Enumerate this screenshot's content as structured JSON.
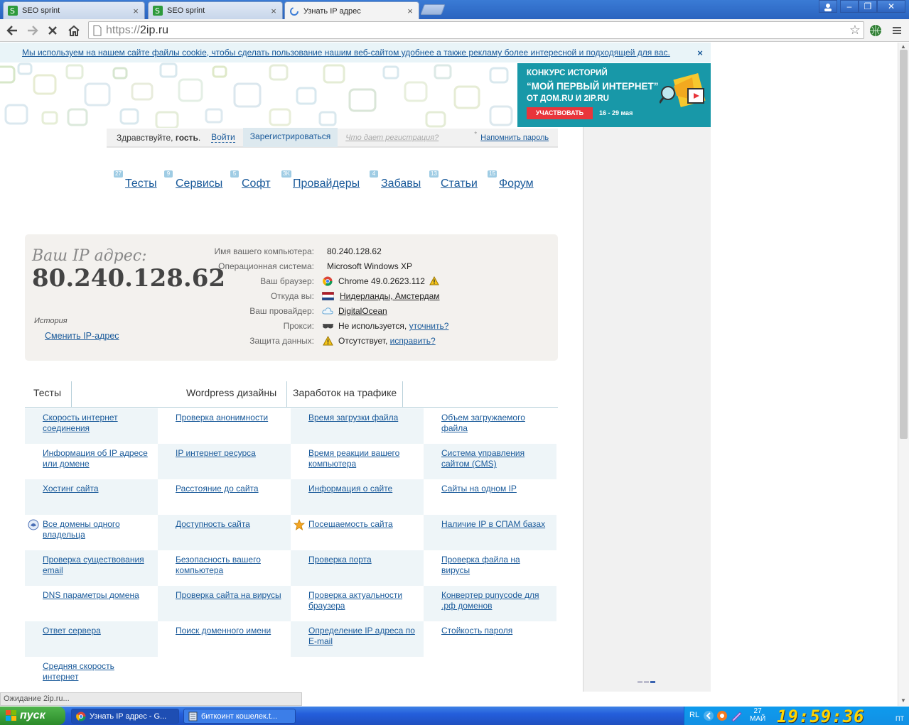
{
  "browser": {
    "tabs": [
      {
        "title": "SEO sprint",
        "active": false
      },
      {
        "title": "SEO sprint",
        "active": false
      },
      {
        "title": "Узнать IP адрес",
        "active": true
      }
    ],
    "url": "https://2ip.ru",
    "url_display_scheme": "https://",
    "url_display_host": "2ip.ru",
    "status": "Ожидание 2ip.ru..."
  },
  "cookie_notice": {
    "text": "Мы используем на нашем сайте файлы cookie, чтобы сделать пользование нашим веб-сайтом удобнее а также рекламу более интересной и подходящей для вас.",
    "close": "×"
  },
  "banner": {
    "line1": "КОНКУРС ИСТОРИЙ",
    "line2": "“МОЙ ПЕРВЫЙ ИНТЕРНЕТ”",
    "line3": "ОТ ДОМ.RU И 2IP.RU",
    "button": "УЧАСТВОВАТЬ",
    "dates": "16 - 29 мая"
  },
  "login_bar": {
    "hello_prefix": "Здравствуйте,",
    "hello_name": "гость",
    "hello_suffix": ".",
    "login": "Войти",
    "register": "Зарегистрироваться",
    "why": "Что дает регистрация?",
    "asterisk": "*",
    "remind": "Напомнить пароль"
  },
  "nav": [
    {
      "label": "Тесты",
      "count": "27"
    },
    {
      "label": "Сервисы",
      "count": "9"
    },
    {
      "label": "Софт",
      "count": "5"
    },
    {
      "label": "Провайдеры",
      "count": "3K"
    },
    {
      "label": "Забавы",
      "count": "4"
    },
    {
      "label": "Статьи",
      "count": "13"
    },
    {
      "label": "Форум",
      "count": "15"
    }
  ],
  "ip_block": {
    "caption": "Ваш IP адрес:",
    "ip": "80.240.128.62",
    "history": "История",
    "change": "Сменить IP-адрес",
    "rows": [
      {
        "key": "Имя вашего компьютера:",
        "value": "80.240.128.62",
        "link": false,
        "icon": ""
      },
      {
        "key": "Операционная система:",
        "value": "Microsoft Windows XP",
        "link": false,
        "icon": ""
      },
      {
        "key": "Ваш браузер:",
        "value": "Chrome 49.0.2623.112",
        "link": false,
        "icon": "chrome-icon"
      },
      {
        "key": "Откуда вы:",
        "value": "Нидерланды, Амстердам",
        "link": true,
        "icon": "netherlands-flag-icon"
      },
      {
        "key": "Ваш провайдер:",
        "value": "DigitalOcean",
        "link": true,
        "icon": "cloud-icon"
      },
      {
        "key": "Прокси:",
        "value": "Не используется,",
        "extra": "уточнить?",
        "link": false,
        "icon": "glasses-icon"
      },
      {
        "key": "Защита данных:",
        "value": "Отсутствует,",
        "extra": "исправить?",
        "link": false,
        "icon": "warning-icon"
      }
    ]
  },
  "section_tabs": {
    "tests": "Тесты",
    "wordpress": "Wordpress дизайны",
    "earn": "Заработок на трафике"
  },
  "tests_grid": [
    [
      "Скорость интернет соединения",
      "Проверка анонимности",
      "Время загрузки файла",
      "Объем загружаемого файла"
    ],
    [
      "Информация об IP адресе или домене",
      "IP интернет ресурса",
      "Время реакции вашего компьютера",
      "Система управления сайтом (CMS)"
    ],
    [
      "Хостинг сайта",
      "Расстояние до сайта",
      "Информация о сайте",
      "Сайты на одном IP"
    ],
    [
      "Все домены одного владельца",
      "Доступность сайта",
      "Посещаемость сайта",
      "Наличие IP в СПАМ базах"
    ],
    [
      "Проверка существования email",
      "Безопасность вашего компьютера",
      "Проверка порта",
      "Проверка файла на вирусы"
    ],
    [
      "DNS параметры домена",
      "Проверка сайта на вирусы",
      "Проверка актуальности браузера",
      "Конвертер punycode для .рф доменов"
    ],
    [
      "Ответ сервера",
      "Поиск доменного имени",
      "Определение IP адреса по E-mail",
      "Стойкость пароля"
    ],
    [
      "Средняя скорость интернет",
      "",
      "",
      ""
    ]
  ],
  "taskbar": {
    "start": "пуск",
    "tasks": [
      "Узнать IP адрес - G...",
      "биткоинт кошелек.t..."
    ],
    "lang": "RL",
    "date_day": "27",
    "date_month": "МАЙ",
    "clock": "19:59:36",
    "dow": "ПТ"
  },
  "colors": {
    "link": "#1a5a9a",
    "banner_bg": "#1898a8",
    "banner_button": "#e8353b",
    "grid_shade": "#eef5f8",
    "ip_block_bg": "#f3f1ee"
  }
}
